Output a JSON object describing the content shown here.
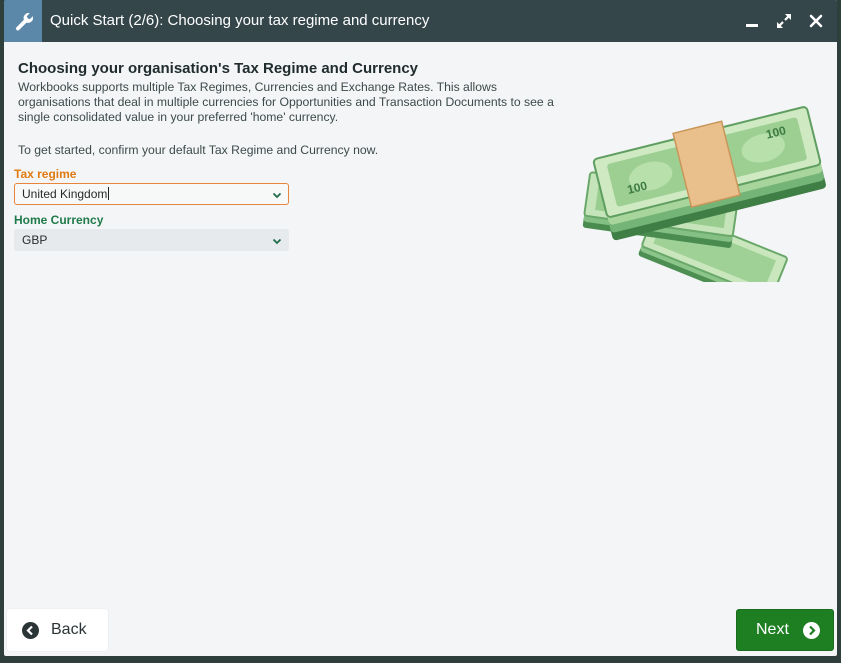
{
  "window": {
    "title": "Quick Start (2/6): Choosing your tax regime and currency"
  },
  "page": {
    "heading": "Choosing your organisation's Tax Regime and Currency",
    "intro": "Workbooks supports multiple Tax Regimes, Currencies and Exchange Rates. This allows organisations that deal in multiple currencies for Opportunities and Transaction Documents to see a single consolidated value in your preferred 'home' currency.",
    "instruction": "To get started, confirm your default Tax Regime and Currency now."
  },
  "form": {
    "tax_regime": {
      "label": "Tax regime",
      "value": "United Kingdom"
    },
    "home_currency": {
      "label": "Home Currency",
      "value": "GBP"
    }
  },
  "illustration": {
    "note_denomination": "100"
  },
  "nav": {
    "back_label": "Back",
    "next_label": "Next"
  },
  "colors": {
    "titlebar": "#34464a",
    "app_icon_bg": "#5b87a8",
    "tax_label": "#e07a12",
    "currency_label": "#1e7a4a",
    "next_button": "#1e7e22"
  },
  "icons": {
    "app": "wrench-icon",
    "minimize": "minimize-icon",
    "maximize": "maximize-icon",
    "close": "close-icon",
    "back": "arrow-left-circle-icon",
    "next": "arrow-right-circle-icon",
    "dropdown": "chevron-down-icon"
  }
}
